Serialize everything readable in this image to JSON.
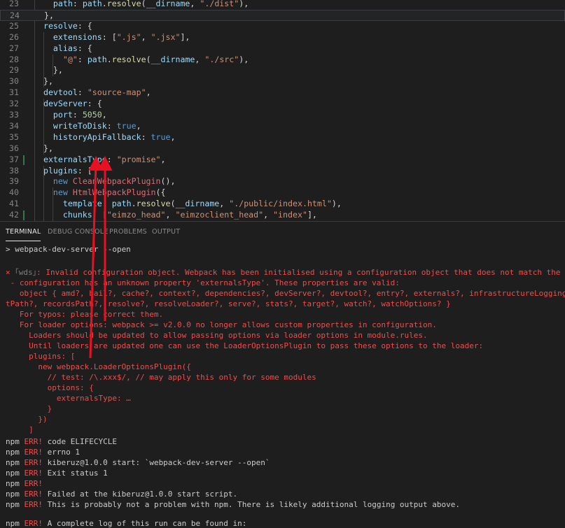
{
  "editor": {
    "lines": [
      {
        "num": "23",
        "tokens": [
          [
            "p",
            "    "
          ],
          [
            "k",
            "path"
          ],
          [
            "p",
            ": "
          ],
          [
            "k",
            "path"
          ],
          [
            "p",
            "."
          ],
          [
            "f",
            "resolve"
          ],
          [
            "p",
            "("
          ],
          [
            "k",
            "__dirname"
          ],
          [
            "p",
            ", "
          ],
          [
            "s",
            "\"./dist\""
          ],
          [
            "p",
            "),"
          ]
        ]
      },
      {
        "num": "24",
        "tokens": [
          [
            "p",
            "  },"
          ]
        ]
      },
      {
        "num": "25",
        "tokens": [
          [
            "p",
            "  "
          ],
          [
            "k",
            "resolve"
          ],
          [
            "p",
            ": {"
          ]
        ]
      },
      {
        "num": "26",
        "tokens": [
          [
            "p",
            "    "
          ],
          [
            "k",
            "extensions"
          ],
          [
            "p",
            ": ["
          ],
          [
            "s",
            "\".js\""
          ],
          [
            "p",
            ", "
          ],
          [
            "s",
            "\".jsx\""
          ],
          [
            "p",
            "],"
          ]
        ]
      },
      {
        "num": "27",
        "tokens": [
          [
            "p",
            "    "
          ],
          [
            "k",
            "alias"
          ],
          [
            "p",
            ": {"
          ]
        ]
      },
      {
        "num": "28",
        "tokens": [
          [
            "p",
            "      "
          ],
          [
            "s",
            "\"@\""
          ],
          [
            "p",
            ": "
          ],
          [
            "k",
            "path"
          ],
          [
            "p",
            "."
          ],
          [
            "f",
            "resolve"
          ],
          [
            "p",
            "("
          ],
          [
            "k",
            "__dirname"
          ],
          [
            "p",
            ", "
          ],
          [
            "s",
            "\"./src\""
          ],
          [
            "p",
            "),"
          ]
        ]
      },
      {
        "num": "29",
        "tokens": [
          [
            "p",
            "    },"
          ]
        ]
      },
      {
        "num": "30",
        "tokens": [
          [
            "p",
            "  },"
          ]
        ]
      },
      {
        "num": "31",
        "tokens": [
          [
            "p",
            "  "
          ],
          [
            "k",
            "devtool"
          ],
          [
            "p",
            ": "
          ],
          [
            "s",
            "\"source-map\""
          ],
          [
            "p",
            ","
          ]
        ]
      },
      {
        "num": "32",
        "tokens": [
          [
            "p",
            "  "
          ],
          [
            "k",
            "devServer"
          ],
          [
            "p",
            ": {"
          ]
        ]
      },
      {
        "num": "33",
        "tokens": [
          [
            "p",
            "    "
          ],
          [
            "k",
            "port"
          ],
          [
            "p",
            ": "
          ],
          [
            "n",
            "5050"
          ],
          [
            "p",
            ","
          ]
        ]
      },
      {
        "num": "34",
        "tokens": [
          [
            "p",
            "    "
          ],
          [
            "k",
            "writeToDisk"
          ],
          [
            "p",
            ": "
          ],
          [
            "b",
            "true"
          ],
          [
            "p",
            ","
          ]
        ]
      },
      {
        "num": "35",
        "tokens": [
          [
            "p",
            "    "
          ],
          [
            "k",
            "historyApiFallback"
          ],
          [
            "p",
            ": "
          ],
          [
            "b",
            "true"
          ],
          [
            "p",
            ","
          ]
        ]
      },
      {
        "num": "36",
        "tokens": [
          [
            "p",
            "  },"
          ]
        ]
      },
      {
        "num": "37",
        "tokens": [
          [
            "p",
            "  "
          ],
          [
            "k",
            "externalsType"
          ],
          [
            "p",
            ": "
          ],
          [
            "s",
            "\"promise\""
          ],
          [
            "p",
            ","
          ]
        ]
      },
      {
        "num": "38",
        "tokens": [
          [
            "p",
            "  "
          ],
          [
            "k",
            "plugins"
          ],
          [
            "p",
            ": ["
          ]
        ]
      },
      {
        "num": "39",
        "tokens": [
          [
            "p",
            "    "
          ],
          [
            "b",
            "new"
          ],
          [
            "p",
            " "
          ],
          [
            "e",
            "CleanWebpackPlugin"
          ],
          [
            "p",
            "(),"
          ]
        ]
      },
      {
        "num": "40",
        "tokens": [
          [
            "p",
            "    "
          ],
          [
            "b",
            "new"
          ],
          [
            "p",
            " "
          ],
          [
            "e",
            "HtmlWebpackPlugin"
          ],
          [
            "p",
            "({"
          ]
        ]
      },
      {
        "num": "41",
        "tokens": [
          [
            "p",
            "      "
          ],
          [
            "k",
            "template"
          ],
          [
            "p",
            ": "
          ],
          [
            "k",
            "path"
          ],
          [
            "p",
            "."
          ],
          [
            "f",
            "resolve"
          ],
          [
            "p",
            "("
          ],
          [
            "k",
            "__dirname"
          ],
          [
            "p",
            ", "
          ],
          [
            "s",
            "\"./public/index.html\""
          ],
          [
            "p",
            "),"
          ]
        ]
      },
      {
        "num": "42",
        "tokens": [
          [
            "p",
            "      "
          ],
          [
            "k",
            "chunks"
          ],
          [
            "p",
            ": ["
          ],
          [
            "s",
            "\"eimzo_head\""
          ],
          [
            "p",
            ", "
          ],
          [
            "s",
            "\"eimzoclient_head\""
          ],
          [
            "p",
            ", "
          ],
          [
            "s",
            "\"index\""
          ],
          [
            "p",
            "],"
          ]
        ]
      }
    ]
  },
  "panel": {
    "tabs": [
      {
        "label": "TERMINAL",
        "active": true
      },
      {
        "label": "DEBUG CONSOLE",
        "active": false
      },
      {
        "label": "PROBLEMS",
        "active": false
      },
      {
        "label": "OUTPUT",
        "active": false
      }
    ]
  },
  "terminal": {
    "lines": [
      {
        "kind": "cmd",
        "text": "> webpack-dev-server --open"
      },
      {
        "kind": "wds",
        "marker": "×",
        "tag": "｢wds｣",
        "text": ": Invalid configuration object. Webpack has been initialised using a configuration object that does not match the API schema."
      },
      {
        "kind": "err",
        "text": " - configuration has an unknown property 'externalsType'. These properties are valid:"
      },
      {
        "kind": "err",
        "text": "   object { amd?, bail?, cache?, context?, dependencies?, devServer?, devtool?, entry?, externals?, infrastructureLogging?, loader?, modu"
      },
      {
        "kind": "err",
        "text": "tPath?, recordsPath?, resolve?, resolveLoader?, serve?, stats?, target?, watch?, watchOptions? }"
      },
      {
        "kind": "err",
        "text": "   For typos: please correct them."
      },
      {
        "kind": "err",
        "text": "   For loader options: webpack >= v2.0.0 no longer allows custom properties in configuration."
      },
      {
        "kind": "err",
        "text": "     Loaders should be updated to allow passing options via loader options in module.rules."
      },
      {
        "kind": "err",
        "text": "     Until loaders are updated one can use the LoaderOptionsPlugin to pass these options to the loader:"
      },
      {
        "kind": "err",
        "text": "     plugins: ["
      },
      {
        "kind": "err",
        "text": "       new webpack.LoaderOptionsPlugin({"
      },
      {
        "kind": "err",
        "text": "         // test: /\\.xxx$/, // may apply this only for some modules"
      },
      {
        "kind": "err",
        "text": "         options: {"
      },
      {
        "kind": "err",
        "text": "           externalsType: …"
      },
      {
        "kind": "err",
        "text": "         }"
      },
      {
        "kind": "err",
        "text": "       })"
      },
      {
        "kind": "err",
        "text": "     ]"
      },
      {
        "kind": "npm",
        "text": " code ELIFECYCLE"
      },
      {
        "kind": "npm",
        "text": " errno 1"
      },
      {
        "kind": "npm",
        "text": " kiberuz@1.0.0 start: `webpack-dev-server --open`"
      },
      {
        "kind": "npm",
        "text": " Exit status 1"
      },
      {
        "kind": "npm",
        "text": ""
      },
      {
        "kind": "npm",
        "text": " Failed at the kiberuz@1.0.0 start script."
      },
      {
        "kind": "npm",
        "text": " This is probably not a problem with npm. There is likely additional logging output above."
      },
      {
        "kind": "npm-gap",
        "text": " A complete log of this run can be found in:"
      }
    ],
    "npm_label": "npm",
    "err_label": "ERR!"
  },
  "colors": {
    "annotation_arrow": "#e81123",
    "error_text": "#f14c4c",
    "editor_background": "#1e1e1e"
  }
}
